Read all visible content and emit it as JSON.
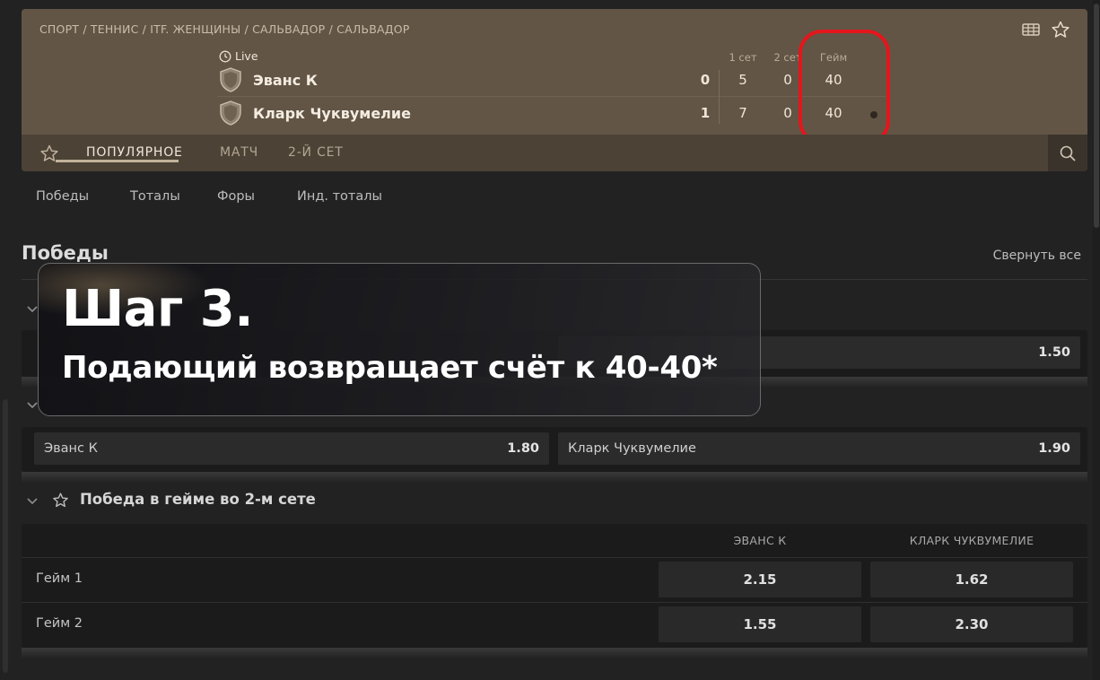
{
  "breadcrumb": "СПОРТ / ТЕННИС / ITF. ЖЕНЩИНЫ / САЛЬВАДОР / САЛЬВАДОР",
  "header": {
    "live_label": "Live",
    "columns": {
      "set1": "1 сет",
      "set2": "2 сет",
      "game": "Гейм"
    },
    "teams": [
      {
        "name": "Эванс К",
        "sets": "0",
        "set1": "5",
        "set2": "0",
        "game": "40"
      },
      {
        "name": "Кларк Чуквумелие",
        "sets": "1",
        "set1": "7",
        "set2": "0",
        "game": "40"
      }
    ]
  },
  "tabs": {
    "popular": "ПОПУЛЯРНОЕ",
    "match": "МАТЧ",
    "set2": "2-Й СЕТ"
  },
  "subnav": {
    "wins": "Победы",
    "totals": "Тоталы",
    "handicaps": "Форы",
    "ind_totals": "Инд. тоталы"
  },
  "section": {
    "title": "Победы",
    "collapse_all": "Свернуть все"
  },
  "markets": {
    "first": {
      "odd_right": "1.50"
    },
    "second": {
      "left_name": "Эванс К",
      "left_odd": "1.80",
      "right_name": "Кларк Чуквумелие",
      "right_odd": "1.90"
    },
    "games": {
      "title": "Победа в гейме во 2-м сете",
      "col1": "ЭВАНС К",
      "col2": "КЛАРК ЧУКВУМЕЛИЕ",
      "rows": [
        {
          "label": "Гейм 1",
          "odd1": "2.15",
          "odd2": "1.62"
        },
        {
          "label": "Гейм 2",
          "odd1": "1.55",
          "odd2": "2.30"
        }
      ]
    }
  },
  "overlay": {
    "step": "Шаг 3.",
    "text": "Подающий возвращает счёт к 40-40*"
  },
  "colors": {
    "header_bg": "#625545",
    "highlight": "#e4161c",
    "page_bg": "#222222"
  },
  "icons": [
    "clock-icon",
    "shield-icon",
    "scoreboard-icon",
    "star-icon",
    "search-icon",
    "chevron-down-icon"
  ]
}
